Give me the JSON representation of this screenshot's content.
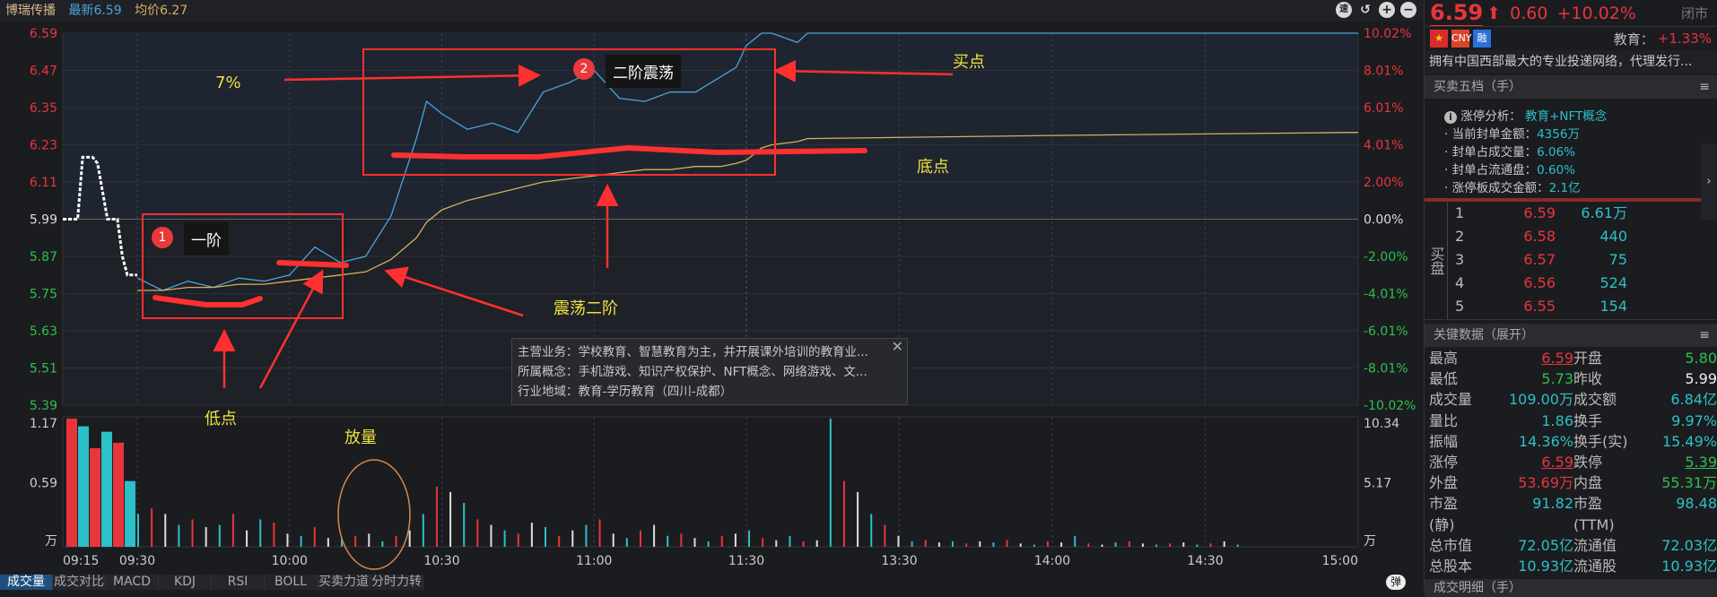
{
  "header": {
    "stock_name": "博瑞传播",
    "latest": "最新6.59",
    "avg_price": "均价6.27",
    "tools": [
      "速",
      "↺",
      "+",
      "−"
    ]
  },
  "price_axis": {
    "left": [
      "6.59",
      "6.47",
      "6.35",
      "6.23",
      "6.11",
      "5.99",
      "5.87",
      "5.75",
      "5.63",
      "5.51",
      "5.39"
    ],
    "right": [
      "10.02%",
      "8.01%",
      "6.01%",
      "4.01%",
      "2.00%",
      "0.00%",
      "-2.00%",
      "-4.01%",
      "-6.01%",
      "-8.01%",
      "-10.02%"
    ]
  },
  "volume_axis": {
    "left": [
      "1.17",
      "0.59",
      "万"
    ],
    "right": [
      "10.34",
      "5.17",
      "万"
    ]
  },
  "time_axis": [
    "09:15",
    "09:30",
    "10:00",
    "10:30",
    "11:00",
    "11:30",
    "13:30",
    "14:00",
    "14:30",
    "15:00"
  ],
  "colors": {
    "up": "#e8353c",
    "down": "#2ec04a",
    "price_line": "#4aa3e0",
    "avg_line": "#d8b060",
    "annotation": "#ff3030",
    "note": "#f0e040"
  },
  "chart_data": {
    "type": "line",
    "title": "博瑞传播 分时",
    "prev_close": 5.99,
    "ylim": [
      5.39,
      6.59
    ],
    "premarket": {
      "x": [
        "09:15",
        "09:18",
        "09:19",
        "09:21",
        "09:22",
        "09:24",
        "09:26",
        "09:27",
        "09:28",
        "09:30"
      ],
      "price": [
        5.99,
        5.99,
        6.19,
        6.19,
        6.17,
        5.99,
        5.99,
        5.87,
        5.81,
        5.81
      ]
    },
    "x": [
      "09:30",
      "09:35",
      "09:40",
      "09:45",
      "09:50",
      "09:55",
      "10:00",
      "10:05",
      "10:10",
      "10:15",
      "10:20",
      "10:25",
      "10:27",
      "10:30",
      "10:35",
      "10:40",
      "10:45",
      "10:50",
      "10:55",
      "11:00",
      "11:05",
      "11:10",
      "11:15",
      "11:20",
      "11:25",
      "11:28",
      "11:30",
      "13:03",
      "13:05",
      "13:10",
      "13:12",
      "14:00",
      "15:00"
    ],
    "series": [
      {
        "name": "价格",
        "values": [
          5.8,
          5.76,
          5.79,
          5.77,
          5.8,
          5.79,
          5.81,
          5.9,
          5.85,
          5.87,
          6.0,
          6.25,
          6.37,
          6.33,
          6.28,
          6.3,
          6.27,
          6.4,
          6.43,
          6.47,
          6.38,
          6.37,
          6.4,
          6.4,
          6.45,
          6.48,
          6.55,
          6.59,
          6.59,
          6.56,
          6.59,
          6.59,
          6.59
        ]
      },
      {
        "name": "均价",
        "values": [
          5.76,
          5.76,
          5.77,
          5.77,
          5.78,
          5.78,
          5.79,
          5.8,
          5.81,
          5.82,
          5.86,
          5.93,
          5.98,
          6.02,
          6.05,
          6.07,
          6.09,
          6.11,
          6.12,
          6.13,
          6.14,
          6.15,
          6.15,
          6.16,
          6.16,
          6.17,
          6.18,
          6.22,
          6.23,
          6.24,
          6.25,
          6.26,
          6.27
        ]
      }
    ],
    "volume": [
      1.17,
      1.1,
      0.9,
      1.05,
      0.95,
      0.6,
      0.3,
      0.35,
      0.3,
      0.2,
      0.25,
      0.18,
      0.2,
      0.3,
      0.15,
      0.25,
      0.22,
      0.12,
      0.1,
      0.18,
      0.08,
      0.07,
      0.1,
      0.12,
      0.05,
      0.1,
      0.15,
      0.3,
      0.55,
      0.5,
      0.4,
      0.25,
      0.2,
      0.15,
      0.12,
      0.22,
      0.18,
      0.1,
      0.15,
      0.2,
      0.25,
      0.12,
      0.08,
      0.15,
      0.2,
      0.1,
      0.12,
      0.08,
      0.05,
      0.1,
      0.12,
      0.15,
      0.08,
      0.06,
      0.1,
      0.05,
      0.06,
      1.17,
      0.6,
      0.5,
      0.3,
      0.2,
      0.1,
      0.05,
      0.06,
      0.04,
      0.05,
      0.03,
      0.05,
      0.04,
      0.06,
      0.03,
      0.02,
      0.05,
      0.04,
      0.1,
      0.03,
      0.02,
      0.04,
      0.05,
      0.03,
      0.02,
      0.03,
      0.04,
      0.02,
      0.03,
      0.05,
      0.02
    ]
  },
  "annotations": {
    "box1_num": "1",
    "box1_label": "一阶",
    "box2_num": "2",
    "box2_label": "二阶震荡",
    "pct": "7%",
    "buy": "买点",
    "bottom": "底点",
    "oscillate": "震荡二阶",
    "low": "低点",
    "volume_up": "放量"
  },
  "popup": {
    "line1": "主营业务：学校教育、智慧教育为主，并开展课外培训的教育业...",
    "line2": "所属概念：手机游戏、知识产权保护、NFT概念、网络游戏、文...",
    "line3": "行业地域：教育-学历教育（四川-成都）",
    "close": "✕"
  },
  "tabs": [
    "成交量",
    "成交对比",
    "MACD",
    "KDJ",
    "RSI",
    "BOLL",
    "买卖力道",
    "分时力转"
  ],
  "dan": "弹",
  "right": {
    "price": "6.59",
    "arrow": "⬆",
    "change": "0.60",
    "pct": "+10.02%",
    "status": "闭市",
    "flags": [
      "CNY",
      "融"
    ],
    "sector": "教育：",
    "sector_pct": "+1.33%",
    "desc": "拥有中国西部最大的专业投递网络，代理发行...",
    "book_title": "买卖五档（手）",
    "menu": "≡",
    "analysis": {
      "title": "涨停分析：",
      "concept": "教育+NFT概念",
      "items": [
        {
          "k": "· 当前封单金额：",
          "v": "4356万"
        },
        {
          "k": "· 封单占成交量：",
          "v": "6.06%"
        },
        {
          "k": "· 封单占流通盘：",
          "v": "0.60%"
        },
        {
          "k": "· 涨停板成交金额：",
          "v": "2.1亿"
        }
      ]
    },
    "buy_side": "买盘",
    "buy": [
      {
        "i": "1",
        "p": "6.59",
        "q": "6.61万"
      },
      {
        "i": "2",
        "p": "6.58",
        "q": "440"
      },
      {
        "i": "3",
        "p": "6.57",
        "q": "75"
      },
      {
        "i": "4",
        "p": "6.56",
        "q": "524"
      },
      {
        "i": "5",
        "p": "6.55",
        "q": "154"
      }
    ],
    "key_title": "关键数据（展开）",
    "key": [
      [
        "最高",
        "6.59",
        "开盘",
        "5.80"
      ],
      [
        "最低",
        "5.73",
        "昨收",
        "5.99"
      ],
      [
        "成交量",
        "109.00万",
        "成交额",
        "6.84亿"
      ],
      [
        "量比",
        "1.86",
        "换手",
        "9.97%"
      ],
      [
        "振幅",
        "14.36%",
        "换手(实)",
        "15.49%"
      ],
      [
        "涨停",
        "6.59",
        "跌停",
        "5.39"
      ],
      [
        "外盘",
        "53.69万",
        "内盘",
        "55.31万"
      ],
      [
        "市盈(静)",
        "91.82",
        "市盈(TTM)",
        "98.48"
      ],
      [
        "总市值",
        "72.05亿",
        "流通值",
        "72.03亿"
      ],
      [
        "总股本",
        "10.93亿",
        "流通股",
        "10.93亿"
      ]
    ],
    "detail_title": "成交明细（手）"
  }
}
